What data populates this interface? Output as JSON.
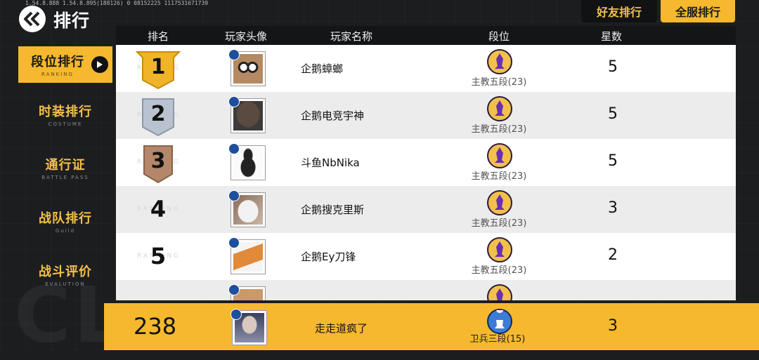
{
  "debug_text": "1.54.8.888  1.54.8.895(188126)  0  08152225  1117531671739",
  "header": {
    "title": "排行"
  },
  "tabs": {
    "friends": "好友排行",
    "server": "全服排行"
  },
  "sidebar": {
    "items": [
      {
        "label": "段位排行",
        "sub": "RANKING"
      },
      {
        "label": "时装排行",
        "sub": "COSTUME"
      },
      {
        "label": "通行证",
        "sub": "BATTLE PASS"
      },
      {
        "label": "战队排行",
        "sub": "Guild"
      },
      {
        "label": "战斗评价",
        "sub": "EVALUTION"
      }
    ]
  },
  "columns": [
    "排名",
    "玩家头像",
    "玩家名称",
    "段位",
    "星数"
  ],
  "row_watermark": "RANKING",
  "rows": [
    {
      "rank": "1",
      "name": "企鹅蟑螂",
      "tier": "主教五段(23)",
      "stars": "5",
      "medal_color": "#f0b429"
    },
    {
      "rank": "2",
      "name": "企鹅电竞宇神",
      "tier": "主教五段(23)",
      "stars": "5",
      "medal_color": "#b8c2d0"
    },
    {
      "rank": "3",
      "name": "斗鱼NbNika",
      "tier": "主教五段(23)",
      "stars": "5",
      "medal_color": "#b4876a"
    },
    {
      "rank": "4",
      "name": "企鹅搜克里斯",
      "tier": "主教五段(23)",
      "stars": "3"
    },
    {
      "rank": "5",
      "name": "企鹅Ey刀锋",
      "tier": "主教五段(23)",
      "stars": "2"
    }
  ],
  "self": {
    "rank": "238",
    "name": "走走道疯了",
    "tier": "卫兵三段(15)",
    "stars": "3"
  },
  "colors": {
    "accent": "#f5b82e",
    "panel": "#141517",
    "bishop": "#6a2fb0",
    "guard": "#3d7bd6"
  }
}
